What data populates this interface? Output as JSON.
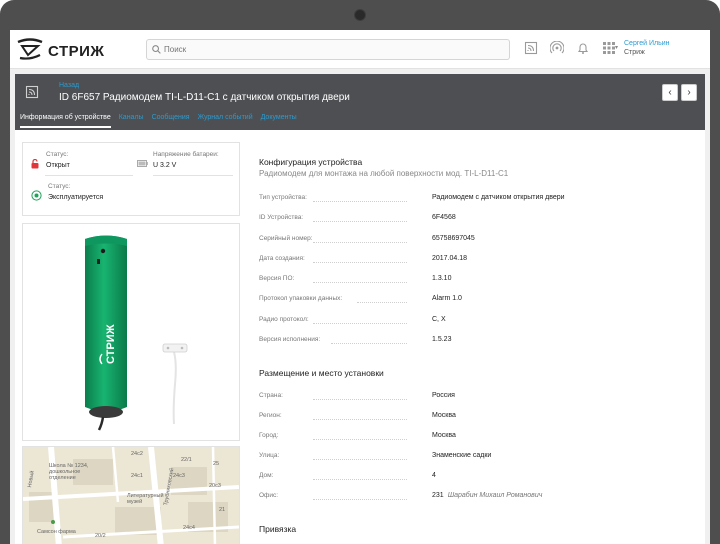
{
  "app": {
    "logo_text": "СТРИЖ",
    "search_placeholder": "Поиск",
    "user": {
      "name": "Сергей Ильин",
      "org": "Стриж"
    }
  },
  "header": {
    "back_label": "Назад",
    "title": "ID 6F657  Радиомодем TI-L-D11-C1 с датчиком открытия двери",
    "tabs": [
      {
        "label": "Информация об устройстве",
        "active": true
      },
      {
        "label": "Каналы"
      },
      {
        "label": "Сообщения"
      },
      {
        "label": "Журнал событий"
      },
      {
        "label": "Документы"
      }
    ]
  },
  "status": {
    "state_label": "Статус:",
    "state_value": "Открыт",
    "battery_label": "Напряжение батареи:",
    "battery_value": "U 3.2 V",
    "op_label": "Статус:",
    "op_value": "Эксплуатируется"
  },
  "product_logo": "СТРИЖ",
  "map": {
    "labels": [
      "Новый",
      "Школа № 1234, дошкольное отделение",
      "Трубниковский",
      "Литературный музей",
      "Самсон фарма",
      "24с2",
      "24с1",
      "24с3",
      "24с4",
      "20/2",
      "22/1",
      "25",
      "20с3",
      "21"
    ]
  },
  "config": {
    "title": "Конфигурация устройства",
    "subtitle": "Радиомодем для монтажа на любой поверхности мод. TI-L-D11-C1",
    "rows": [
      {
        "label": "Тип устройства:",
        "value": "Радиомодем с датчиком открытия двери"
      },
      {
        "label": "ID Устройства:",
        "value": "6F4568"
      },
      {
        "label": "Серийный номер:",
        "value": "65758697045"
      },
      {
        "label": "Дата создания:",
        "value": "2017.04.18"
      },
      {
        "label": "Версия ПО:",
        "value": "1.3.10"
      },
      {
        "label": "Протокол упаковки данных:",
        "value": "Alarm 1.0"
      },
      {
        "label": "Радио протокол:",
        "value": "C, X"
      },
      {
        "label": "Версия исполнения:",
        "value": "1.5.23"
      }
    ]
  },
  "location": {
    "title": "Размещение и место установки",
    "rows": [
      {
        "label": "Страна:",
        "value": "Россия"
      },
      {
        "label": "Регион:",
        "value": "Москва"
      },
      {
        "label": "Город:",
        "value": "Москва"
      },
      {
        "label": "Улица:",
        "value": "Знаменские садки"
      },
      {
        "label": "Дом:",
        "value": "4"
      },
      {
        "label": "Офис:",
        "value": "231",
        "note": "Шарабин Михаил Романович"
      }
    ]
  },
  "binding": {
    "title": "Привязка"
  },
  "colors": {
    "accent": "#2b9bd1",
    "header_bg": "#4d4f52",
    "device_green": "#12a063",
    "alert_red": "#e0353b",
    "ok_green": "#1fa35a"
  }
}
